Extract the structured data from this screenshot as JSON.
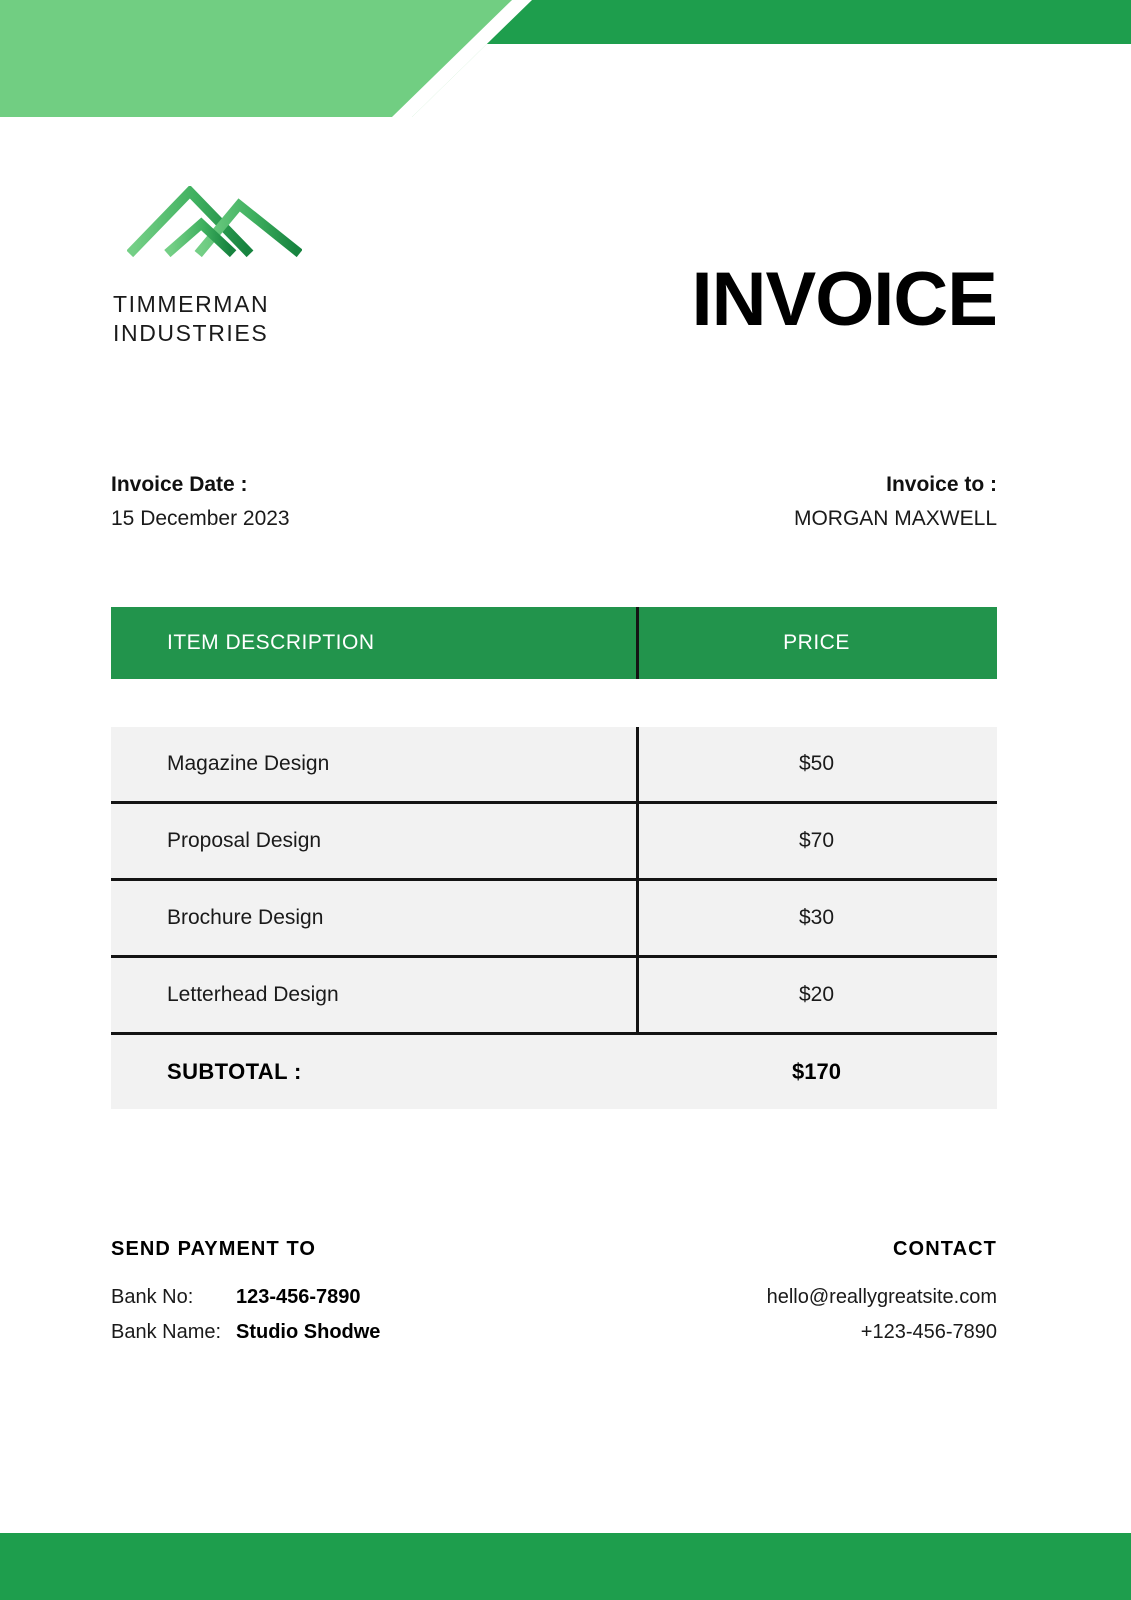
{
  "document": {
    "title": "INVOICE",
    "brand": {
      "logo_icon": "mountain-chevron-logo",
      "name": "TIMMERMAN\nINDUSTRIES"
    }
  },
  "meta": {
    "date_label": "Invoice Date :",
    "date_value": "15 December 2023",
    "to_label": "Invoice to :",
    "to_value": "MORGAN MAXWELL"
  },
  "table": {
    "headers": {
      "description": "ITEM DESCRIPTION",
      "price": "PRICE"
    },
    "rows": [
      {
        "description": "Magazine Design",
        "price": "$50"
      },
      {
        "description": "Proposal Design",
        "price": "$70"
      },
      {
        "description": "Brochure Design",
        "price": "$30"
      },
      {
        "description": "Letterhead Design",
        "price": "$20"
      }
    ],
    "subtotal": {
      "label": "SUBTOTAL :",
      "value": "$170"
    }
  },
  "footer": {
    "payment": {
      "title": "SEND PAYMENT TO",
      "bank_no_label": "Bank No:",
      "bank_no_value": "123-456-7890",
      "bank_name_label": "Bank Name:",
      "bank_name_value": "Studio Shodwe"
    },
    "contact": {
      "title": "CONTACT",
      "email": "hello@reallygreatsite.com",
      "phone": "+123-456-7890"
    }
  },
  "colors": {
    "green_light": "#71ce82",
    "green_dark": "#1e9e4d",
    "green_table_header": "#22944c",
    "row_background": "#f2f2f2",
    "rule": "#141414"
  }
}
